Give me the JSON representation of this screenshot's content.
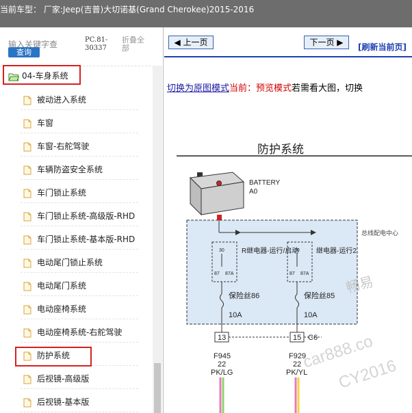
{
  "title": "当前车型： 厂家:Jeep(吉普)大切诺基(Grand Cherokee)2015-2016",
  "sidebar": {
    "search_placeholder": "输入关键字查",
    "query_label": "查询",
    "pc_code": "PC.81-30337",
    "collapse_label": "折叠全部",
    "folder": "04-车身系统",
    "items": [
      "被动进入系统",
      "车窗",
      "车窗-右舵驾驶",
      "车辆防盗安全系统",
      "车门锁止系统",
      "车门锁止系统-高级版-RHD",
      "车门锁止系统-基本版-RHD",
      "电动尾门锁止系统",
      "电动尾门系统",
      "电动座椅系统",
      "电动座椅系统-右舵驾驶",
      "防护系统",
      "后视镜-高级版",
      "后视镜-基本版"
    ],
    "selected_item": "防护系统"
  },
  "toolbar": {
    "prev_label": "上一页",
    "next_label": "下一页",
    "refresh_label": "[刷新当前页]"
  },
  "mode_bar": {
    "switch_link": "切换为原图模式",
    "current_label": "当前：预览模式",
    "hint": "若需看大图，切换"
  },
  "diagram": {
    "title": "防护系统",
    "battery_label": "BATTERY",
    "battery_code": "A0",
    "relay1_label": "R继电器-运行/启动",
    "relay2_label": "继电器-运行2",
    "fuse1_label": "保险丝86",
    "fuse1_amp": "10A",
    "fuse2_label": "保险丝85",
    "fuse2_amp": "10A",
    "connector1_pin": "13",
    "connector2_pin": "15",
    "connector_name": "C6",
    "wire1_code": "F945",
    "wire1_gauge": "22",
    "wire1_color": "PK/LG",
    "wire2_code": "F929",
    "wire2_gauge": "22",
    "wire2_color": "PK/YL",
    "pdc_label": "总线配电中心",
    "watermark1": "畅易",
    "watermark2": "car888.co",
    "watermark3": "CY2016"
  },
  "colors": {
    "highlight_border": "#d62020",
    "title_bar": "#6d6d6d",
    "link": "#1a1aa6"
  }
}
